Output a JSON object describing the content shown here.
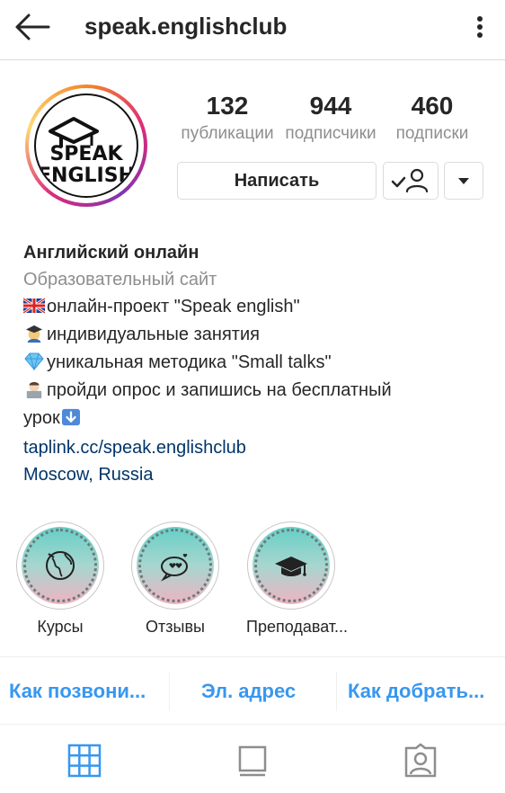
{
  "header": {
    "username": "speak.englishclub"
  },
  "avatar": {
    "logo_line1": "SPEAK",
    "logo_line2": "ENGLISH"
  },
  "stats": [
    {
      "value": "132",
      "label": "публикации"
    },
    {
      "value": "944",
      "label": "подписчики"
    },
    {
      "value": "460",
      "label": "подписки"
    }
  ],
  "actions": {
    "message_label": "Написать"
  },
  "bio": {
    "name": "Английский онлайн",
    "category": "Образовательный сайт",
    "lines": [
      "онлайн-проект \"Speak english\"",
      "индивидуальные занятия",
      "уникальная методика \"Small talks\"",
      "пройди опрос и запишись на бесплатный"
    ],
    "line5": "урок",
    "link": "taplink.cc/speak.englishclub",
    "location": "Moscow, Russia"
  },
  "highlights": [
    {
      "label": "Курсы",
      "icon": "globe-icon"
    },
    {
      "label": "Отзывы",
      "icon": "chat-hearts-icon"
    },
    {
      "label": "Преподават...",
      "icon": "graduation-cap-icon"
    }
  ],
  "contacts": {
    "call": "Как позвони...",
    "email": "Эл. адрес",
    "directions": "Как добрать..."
  },
  "colors": {
    "link": "#003569",
    "accent": "#3897f0",
    "secondary_text": "#8e8e8e"
  }
}
